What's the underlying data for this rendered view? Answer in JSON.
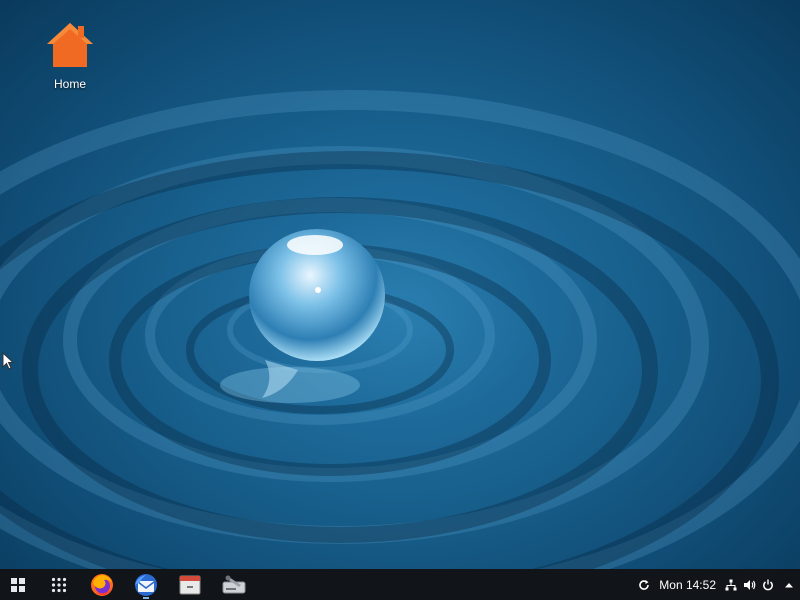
{
  "desktop": {
    "icons": [
      {
        "label": "Home",
        "icon": "home-folder-icon",
        "color": "#f06a23"
      }
    ]
  },
  "taskbar": {
    "launchers": [
      {
        "name": "firefox",
        "icon": "firefox-icon"
      },
      {
        "name": "mail",
        "icon": "mail-client-icon"
      },
      {
        "name": "files",
        "icon": "file-manager-icon"
      },
      {
        "name": "disk-tool",
        "icon": "disk-utility-icon"
      }
    ],
    "tray": {
      "clock": "Mon 14:52",
      "icons": [
        "refresh-icon",
        "network-icon",
        "volume-icon",
        "power-icon",
        "tray-expand-icon"
      ]
    }
  }
}
